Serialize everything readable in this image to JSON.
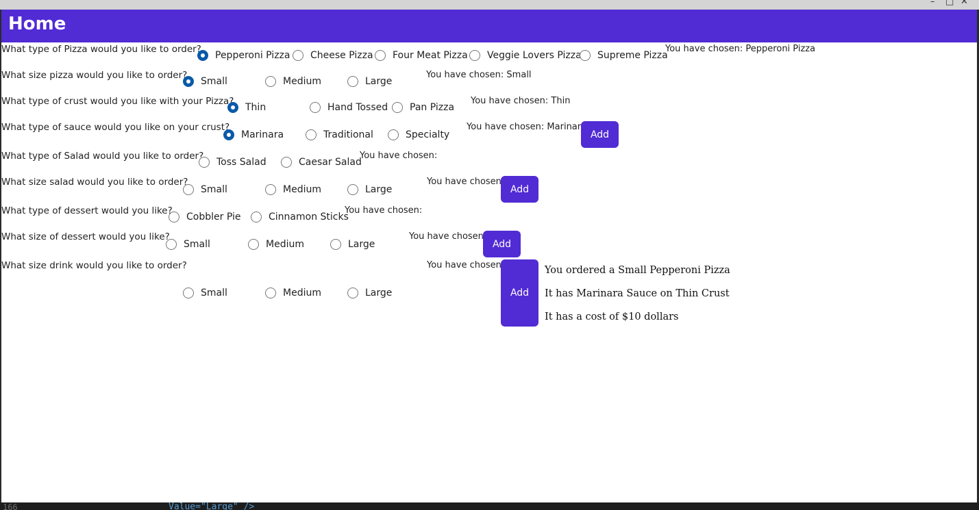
{
  "window": {
    "minimize_glyph": "–",
    "maximize_glyph": "□",
    "close_glyph": "✕"
  },
  "header": {
    "title": "Home"
  },
  "rows": [
    {
      "question": "What type of Pizza would you like to order?",
      "options": [
        "Pepperoni Pizza",
        "Cheese Pizza",
        "Four Meat Pizza",
        "Veggie Lovers Pizza",
        "Supreme Pizza"
      ],
      "selected": 0,
      "chosen": "You have chosen: Pepperoni Pizza"
    },
    {
      "question": "What size pizza would you like to order?",
      "options": [
        "Small",
        "Medium",
        "Large"
      ],
      "selected": 0,
      "chosen": "You have chosen: Small"
    },
    {
      "question": "What type of crust would you like with your Pizza?",
      "options": [
        "Thin",
        "Hand Tossed",
        "Pan Pizza"
      ],
      "selected": 0,
      "chosen": "You have chosen: Thin"
    },
    {
      "question": "What type of sauce would you like on your crust?",
      "options": [
        "Marinara",
        "Traditional",
        "Specialty"
      ],
      "selected": 0,
      "chosen": "You have chosen: Marinara",
      "button": "Add"
    },
    {
      "question": "What type of Salad would you like to order?",
      "options": [
        "Toss Salad",
        "Caesar Salad"
      ],
      "selected": null,
      "chosen": "You have chosen:"
    },
    {
      "question": "What size salad would you like to order?",
      "options": [
        "Small",
        "Medium",
        "Large"
      ],
      "selected": null,
      "chosen": "You have chosen:",
      "button": "Add"
    },
    {
      "question": "What type of dessert would you like?",
      "options": [
        "Cobbler Pie",
        "Cinnamon Sticks"
      ],
      "selected": null,
      "chosen": "You have chosen:"
    },
    {
      "question": "What size of dessert would you like?",
      "options": [
        "Small",
        "Medium",
        "Large"
      ],
      "selected": null,
      "chosen": "You have chosen:",
      "button": "Add"
    },
    {
      "question": "What size drink would you like to order?",
      "options": [
        "Small",
        "Medium",
        "Large"
      ],
      "selected": null,
      "chosen": "You have chosen:",
      "button": "Add"
    }
  ],
  "summary": [
    "You ordered a Small Pepperoni Pizza",
    "It has Marinara Sauce on Thin Crust",
    "It has a cost of $10 dollars"
  ],
  "colors": {
    "accent": "#512bd4",
    "radio_checked": "#0a5aa8"
  },
  "code": {
    "line_number": "166",
    "text": "Value=\"Large\" />"
  }
}
